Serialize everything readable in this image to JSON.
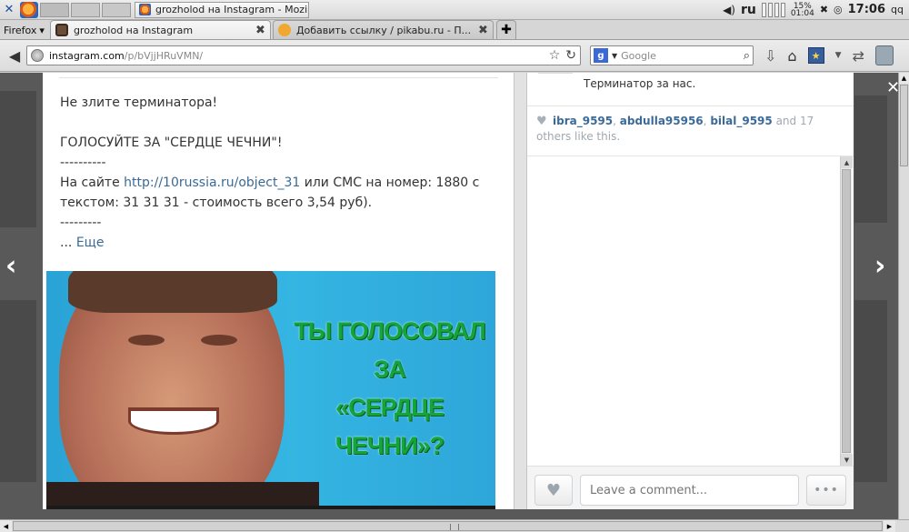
{
  "system_panel": {
    "taskbar_title": "grozholod на Instagram - Mozi...",
    "language": "ru",
    "battery_percent": "15%",
    "battery_time": "01:04",
    "clock": "17:06",
    "user": "qq"
  },
  "browser": {
    "menu_label": "Firefox",
    "tabs": [
      {
        "label": "grozholod на Instagram",
        "active": true
      },
      {
        "label": "Добавить ссылку / pikabu.ru - П...",
        "active": false
      }
    ],
    "url_host": "instagram.com",
    "url_path": "/p/bVjjHRuVMN/",
    "search_placeholder": "Google",
    "search_engine_letter": "g"
  },
  "post": {
    "caption_line1": "Не злите терминатора!",
    "caption_line2": "ГОЛОСУЙТЕ ЗА \"СЕРДЦЕ ЧЕЧНИ\"!",
    "dashes1": "----------",
    "text_before_link": "На сайте ",
    "link_text": "http://10russia.ru/object_31",
    "text_after_link": " или СМС на номер: 1880 с текстом: 31 31 31 - стоимость всего 3,54 руб).",
    "dashes2": "---------",
    "more_prefix": "... ",
    "more_link": "Еще",
    "image_text": [
      "ТЫ ГОЛОСОВАЛ",
      "ЗА",
      "«СЕРДЦЕ ЧЕЧНИ»?"
    ]
  },
  "sidebar": {
    "last_comment": "Терминатор за нас.",
    "likers": [
      "ibra_9595",
      "abdulla95956",
      "bilal_9595"
    ],
    "likes_suffix": "and 17 others like this.",
    "comment_placeholder": "Leave a comment...",
    "more_label": "•••"
  }
}
